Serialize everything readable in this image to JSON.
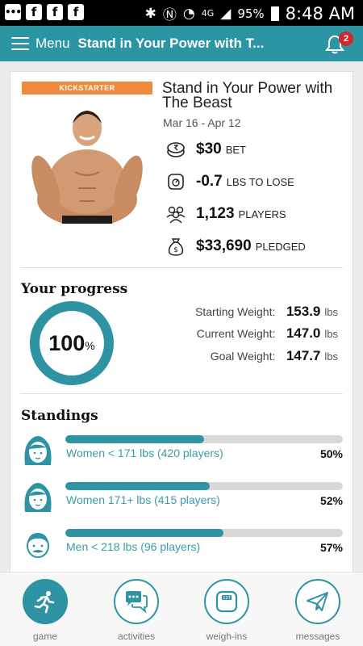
{
  "status_bar": {
    "battery": "95%",
    "network": "4G",
    "time": "8:48 AM"
  },
  "header": {
    "menu_label": "Menu",
    "title": "Stand in Your Power with T...",
    "notification_count": "2"
  },
  "game": {
    "tag": "KICKSTARTER",
    "title": "Stand in Your Power with The Beast",
    "dates": "Mar 16 - Apr 12",
    "stats": [
      {
        "icon": "coins-icon",
        "value": "$30",
        "unit": "BET"
      },
      {
        "icon": "scale-icon",
        "value": "-0.7",
        "unit": "LBS TO LOSE"
      },
      {
        "icon": "players-icon",
        "value": "1,123",
        "unit": "PLAYERS"
      },
      {
        "icon": "money-bag-icon",
        "value": "$33,690",
        "unit": "PLEDGED"
      }
    ]
  },
  "progress": {
    "title": "Your progress",
    "percent": "100",
    "percent_sign": "%",
    "percent_value": 1.0,
    "weights": [
      {
        "label": "Starting Weight:",
        "value": "153.9",
        "unit": "lbs"
      },
      {
        "label": "Current Weight:",
        "value": "147.0",
        "unit": "lbs"
      },
      {
        "label": "Goal Weight:",
        "value": "147.7",
        "unit": "lbs"
      }
    ]
  },
  "standings": {
    "title": "Standings",
    "rows": [
      {
        "avatar": "woman-avatar-icon",
        "label": "Women < 171 lbs (420 players)",
        "percent": "50%",
        "fill": 0.5
      },
      {
        "avatar": "woman-avatar-icon",
        "label": "Women 171+ lbs (415 players)",
        "percent": "52%",
        "fill": 0.52
      },
      {
        "avatar": "man-avatar-icon",
        "label": "Men < 218 lbs (96 players)",
        "percent": "57%",
        "fill": 0.57
      }
    ]
  },
  "bottom_nav": [
    {
      "label": "game",
      "icon": "runner-icon",
      "active": true
    },
    {
      "label": "activities",
      "icon": "chat-bubbles-icon",
      "active": false
    },
    {
      "label": "weigh-ins",
      "icon": "scale-icon",
      "active": false
    },
    {
      "label": "messages",
      "icon": "paper-plane-icon",
      "active": false
    }
  ],
  "colors": {
    "primary": "#2b95a4",
    "tag": "#f08a3c",
    "badge": "#d3262b"
  }
}
